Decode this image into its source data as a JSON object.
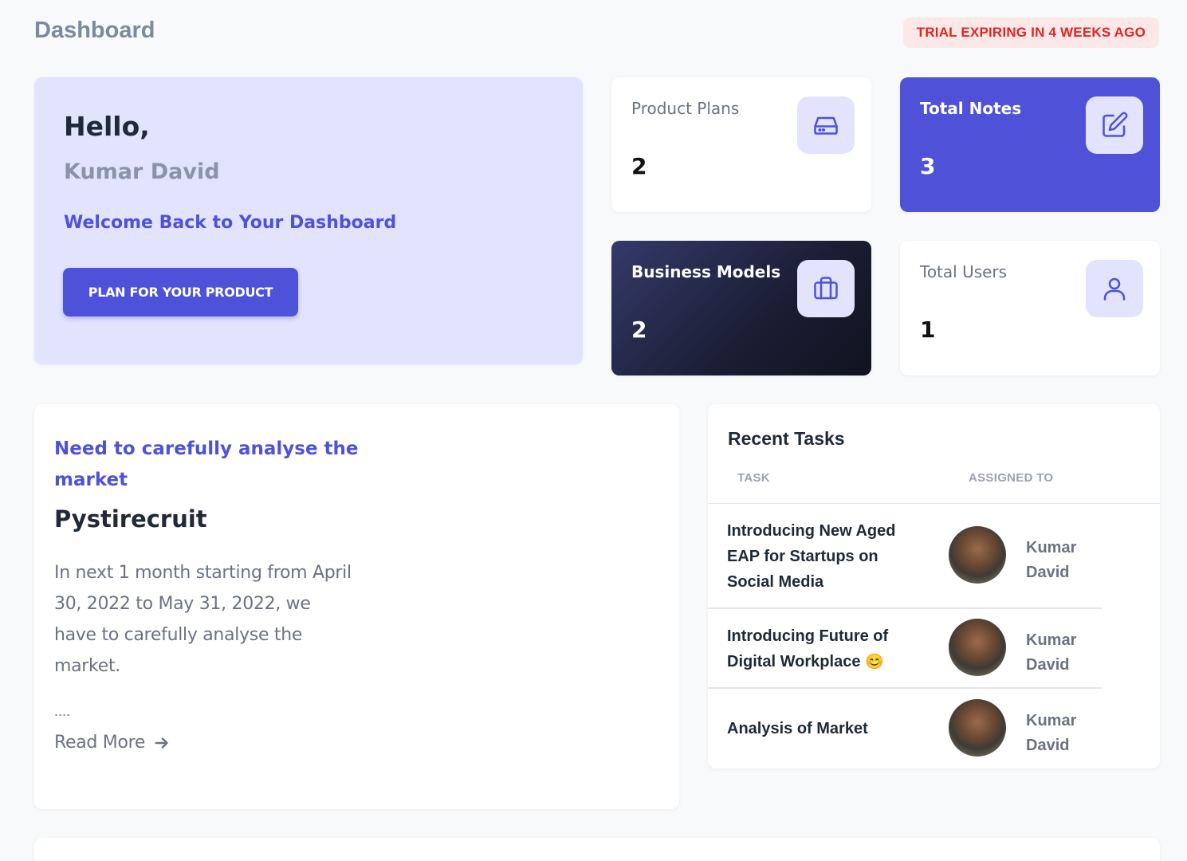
{
  "header": {
    "title": "Dashboard",
    "trial_badge": "TRIAL EXPIRING IN 4 WEEKS AGO"
  },
  "hero": {
    "greeting": "Hello,",
    "user_name": "Kumar David",
    "welcome": "Welcome Back to Your Dashboard",
    "button_label": "PLAN FOR YOUR PRODUCT"
  },
  "stats": [
    {
      "label": "Product Plans",
      "value": "2",
      "icon": "drive-icon"
    },
    {
      "label": "Total Notes",
      "value": "3",
      "icon": "edit-icon"
    },
    {
      "label": "Business Models",
      "value": "2",
      "icon": "briefcase-icon"
    },
    {
      "label": "Total Users",
      "value": "1",
      "icon": "user-icon"
    }
  ],
  "article": {
    "kicker": "Need to carefully analyse the market",
    "title": "Pystirecruit",
    "body": "In next 1 month starting from April 30, 2022 to May 31, 2022, we have to carefully analyse the market.",
    "ellipsis": "....",
    "read_more": "Read More"
  },
  "tasks": {
    "title": "Recent Tasks",
    "columns": [
      "TASK",
      "ASSIGNED TO"
    ],
    "rows": [
      {
        "task": "Introducing New Aged EAP for Startups on Social Media",
        "assignee": "Kumar David"
      },
      {
        "task": "Introducing Future of Digital Workplace",
        "emoji": "😊",
        "assignee": "Kumar David"
      },
      {
        "task": "Analysis of Market",
        "assignee": "Kumar David"
      }
    ]
  },
  "colors": {
    "accent": "#4f52d9",
    "hero_bg": "#e2e3fd",
    "badge_bg": "#fde8e8",
    "badge_text": "#e02424"
  }
}
